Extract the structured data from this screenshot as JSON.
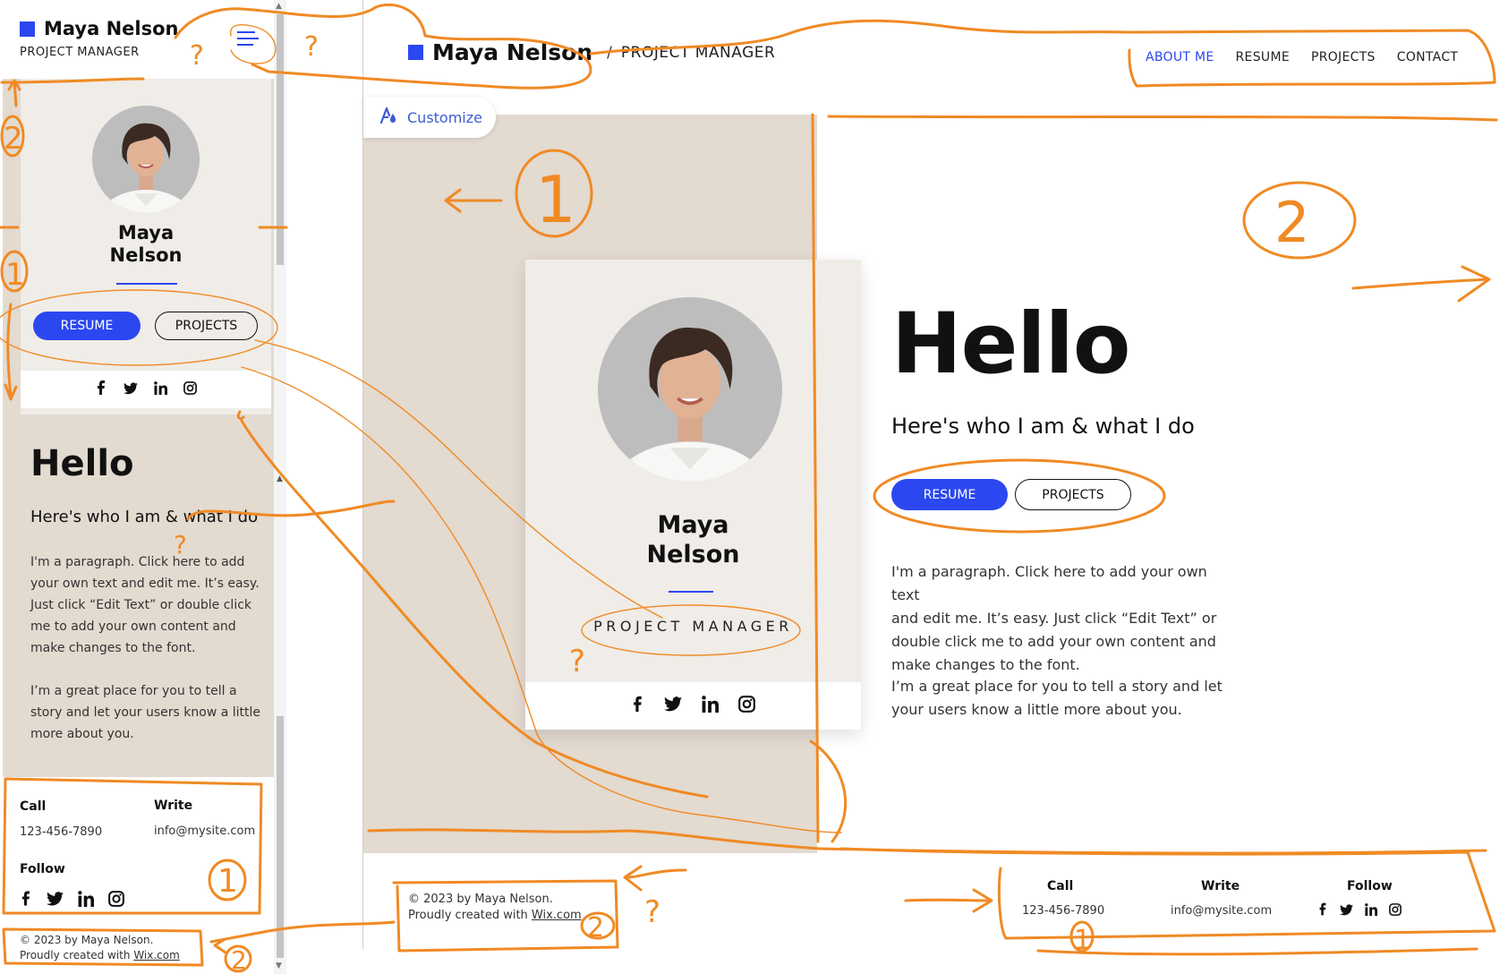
{
  "mobile": {
    "brand_name": "Maya Nelson",
    "role": "PROJECT MANAGER",
    "card_name_first": "Maya",
    "card_name_last": "Nelson",
    "resume_label": "RESUME",
    "projects_label": "PROJECTS",
    "hello": "Hello",
    "subtitle": "Here's who I am & what I do",
    "para1": [
      "I'm a paragraph. Click here to add",
      "your own text and edit me. It’s easy.",
      "Just click “Edit Text” or double click",
      "me to add your own content and",
      "make changes to the font."
    ],
    "para2": [
      "I’m a great place for you to tell a",
      "story and let your users know a little",
      "more about you."
    ],
    "footer": {
      "call_label": "Call",
      "call_value": "123-456-7890",
      "write_label": "Write",
      "write_value": "info@mysite.com",
      "follow_label": "Follow",
      "copyright": "© 2023 by Maya Nelson.",
      "created_prefix": "Proudly created with ",
      "created_link": "Wix.com"
    }
  },
  "desktop": {
    "brand_name": "Maya Nelson",
    "separator": "/",
    "role": "PROJECT MANAGER",
    "nav": [
      "ABOUT ME",
      "RESUME",
      "PROJECTS",
      "CONTACT"
    ],
    "active_nav": "ABOUT ME",
    "customize_label": "Customize",
    "card_name_first": "Maya",
    "card_name_last": "Nelson",
    "card_role": "PROJECT MANAGER",
    "hello": "Hello",
    "subtitle": "Here's who I am & what I do",
    "resume_label": "RESUME",
    "projects_label": "PROJECTS",
    "para1": [
      "I'm a paragraph. Click here to add your own text",
      "and edit me. It’s easy. Just click “Edit Text” or",
      "double click me to add your own content and",
      "make changes to the font."
    ],
    "para2": [
      "I’m a great place for you to tell a story and let",
      "your users know a little more about you."
    ],
    "footer": {
      "copyright": "© 2023 by Maya Nelson.",
      "created_prefix": "Proudly created with ",
      "created_link": "Wix.com",
      "call_label": "Call",
      "call_value": "123-456-7890",
      "write_label": "Write",
      "write_value": "info@mysite.com",
      "follow_label": "Follow"
    }
  },
  "social_icons": [
    "facebook-icon",
    "twitter-icon",
    "linkedin-icon",
    "instagram-icon"
  ],
  "annotations": {
    "mobile_q1": "?",
    "mobile_q2": "?",
    "mobile_num_2": "2",
    "mobile_num_1": "1",
    "mobile_q_sub": "?",
    "mobile_num_1_footer": "1",
    "mobile_num_2_footer": "2",
    "desktop_num_1": "1",
    "desktop_num_2": "2",
    "desktop_q_card": "?",
    "desktop_q_foot": "?",
    "desktop_num_2_foot": "2",
    "desktop_num_1_foot": "1"
  },
  "colors": {
    "accent": "#2b47f0",
    "beige": "#e3dad0",
    "card": "#f0ece7",
    "annotation": "#f08a24"
  }
}
